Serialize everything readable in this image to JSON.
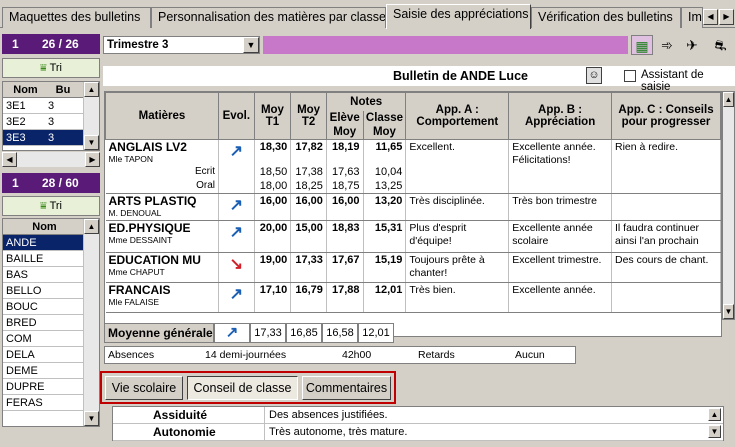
{
  "tabs": [
    "Maquettes des bulletins",
    "Personnalisation des matières par classe",
    "Saisie des appréciations",
    "Vérification des bulletins",
    "Im"
  ],
  "left": {
    "classes_header": {
      "num": "1",
      "count": "26 / 26"
    },
    "tri_label": "Tri",
    "classes_cols": [
      "Nom",
      "Bu"
    ],
    "classes": [
      {
        "nom": "3E1",
        "bu": "3"
      },
      {
        "nom": "3E2",
        "bu": "3"
      },
      {
        "nom": "3E3",
        "bu": "3"
      }
    ],
    "students_header": {
      "num": "1",
      "count": "28 / 60"
    },
    "students_col": "Nom",
    "students": [
      "ANDE",
      "BAILLE",
      "BAS",
      "BELLO",
      "BOUC",
      "BRED",
      "COM",
      "DELA",
      "DEME",
      "DUPRE",
      "FERAS"
    ]
  },
  "period": "Trimestre 3",
  "bulletin_title": "Bulletin de ANDE Luce",
  "assistant_label": "Assistant de saisie",
  "table": {
    "headers": {
      "matieres": "Matières",
      "evol": "Evol.",
      "moy_t1": [
        "Moy",
        "T1"
      ],
      "moy_t2": [
        "Moy",
        "T2"
      ],
      "notes": "Notes",
      "eleve": [
        "Elève",
        "Moy"
      ],
      "classe": [
        "Classe",
        "Moy"
      ],
      "app_a": [
        "App. A :",
        "Comportement"
      ],
      "app_b": [
        "App. B :",
        "Appréciation"
      ],
      "app_c": [
        "App. C : Conseils",
        "pour progresser"
      ]
    },
    "rows": [
      {
        "matiere": "ANGLAIS LV2",
        "prof": "Mle TAPON",
        "evol": "up",
        "t1": "18,30",
        "t2": "17,82",
        "eleve": "18,19",
        "classe": "11,65",
        "app_a": "Excellent.",
        "app_b": "Excellente année. Félicitations!",
        "app_c": "Rien à redire.",
        "sub": [
          {
            "label": "Ecrit",
            "t1": "18,50",
            "t2": "17,38",
            "eleve": "17,63",
            "classe": "10,04"
          },
          {
            "label": "Oral",
            "t1": "18,00",
            "t2": "18,25",
            "eleve": "18,75",
            "classe": "13,25"
          }
        ]
      },
      {
        "matiere": "ARTS PLASTIQ",
        "prof": "M. DENOUAL",
        "evol": "up",
        "t1": "16,00",
        "t2": "16,00",
        "eleve": "16,00",
        "classe": "13,20",
        "app_a": "Très disciplinée.",
        "app_b": "Très bon trimestre",
        "app_c": ""
      },
      {
        "matiere": "ED.PHYSIQUE",
        "prof": "Mme DESSAINT",
        "evol": "up",
        "t1": "20,00",
        "t2": "15,00",
        "eleve": "18,83",
        "classe": "15,31",
        "app_a": "Plus d'esprit d'équipe!",
        "app_b": "Excellente année scolaire",
        "app_c": "Il faudra continuer ainsi l'an prochain"
      },
      {
        "matiere": "EDUCATION MU",
        "prof": "Mme CHAPUT",
        "evol": "down",
        "t1": "19,00",
        "t2": "17,33",
        "eleve": "17,67",
        "classe": "15,19",
        "app_a": "Toujours prête à chanter!",
        "app_b": "Excellent trimestre.",
        "app_c": "Des cours de chant."
      },
      {
        "matiere": "FRANCAIS",
        "prof": "Mle FALAISE",
        "evol": "up",
        "t1": "17,10",
        "t2": "16,79",
        "eleve": "17,88",
        "classe": "12,01",
        "app_a": "Très bien.",
        "app_b": "Excellente année.",
        "app_c": ""
      }
    ]
  },
  "moyenne": {
    "label": "Moyenne générale",
    "t1": "17,33",
    "t2": "16,85",
    "eleve": "16,58",
    "classe": "12,01"
  },
  "absences": {
    "label": "Absences",
    "demi": "14 demi-journées",
    "heures": "42h00",
    "retards_label": "Retards",
    "retards": "Aucun"
  },
  "bottom_tabs": [
    "Vie scolaire",
    "Conseil de classe",
    "Commentaires"
  ],
  "bottom_rows": [
    {
      "label": "Assiduité",
      "value": "Des absences justifiées."
    },
    {
      "label": "Autonomie",
      "value": "Très autonome, très mature."
    }
  ],
  "colors": {
    "up": "#1a5fb4",
    "down": "#d0202a",
    "purple": "#5a1a78",
    "pink": "#c878c8",
    "highlight": "#c00000"
  }
}
